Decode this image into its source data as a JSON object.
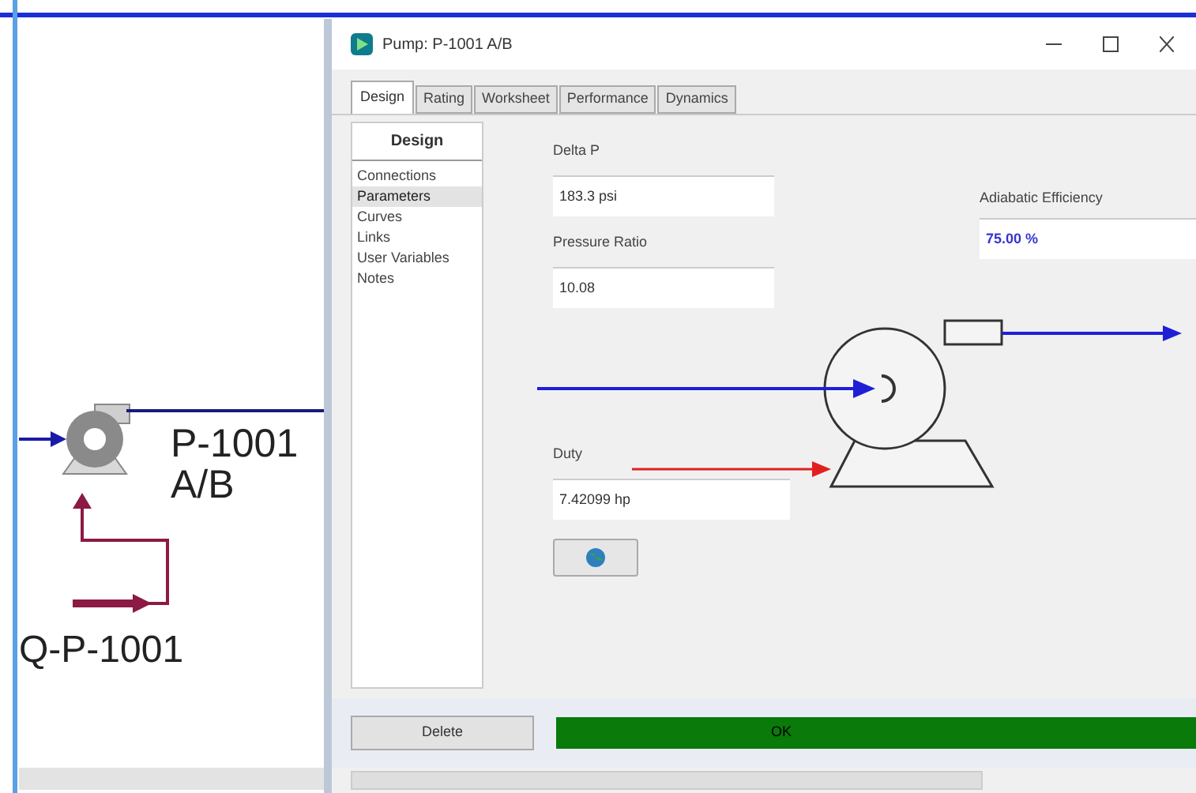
{
  "flowsheet": {
    "pump_label": "P-1001 A/B",
    "energy_stream_label": "Q-P-1001"
  },
  "dialog": {
    "title": "Pump: P-1001 A/B",
    "tabs": [
      {
        "label": "Design",
        "selected": true
      },
      {
        "label": "Rating",
        "selected": false
      },
      {
        "label": "Worksheet",
        "selected": false
      },
      {
        "label": "Performance",
        "selected": false
      },
      {
        "label": "Dynamics",
        "selected": false
      }
    ],
    "nav": {
      "header": "Design",
      "items": [
        {
          "label": "Connections",
          "selected": false
        },
        {
          "label": "Parameters",
          "selected": true
        },
        {
          "label": "Curves",
          "selected": false
        },
        {
          "label": "Links",
          "selected": false
        },
        {
          "label": "User Variables",
          "selected": false
        },
        {
          "label": "Notes",
          "selected": false
        }
      ]
    },
    "fields": [
      {
        "label": "Delta P",
        "value": "183.3 psi"
      },
      {
        "label": "Pressure Ratio",
        "value": "10.08"
      }
    ],
    "efficiency": {
      "label": "Adiabatic Efficiency",
      "value": "75.00 %"
    },
    "duty": {
      "label": "Duty",
      "value": "7.42099 hp"
    },
    "buttons": {
      "delete": "Delete",
      "ok": "OK"
    }
  }
}
